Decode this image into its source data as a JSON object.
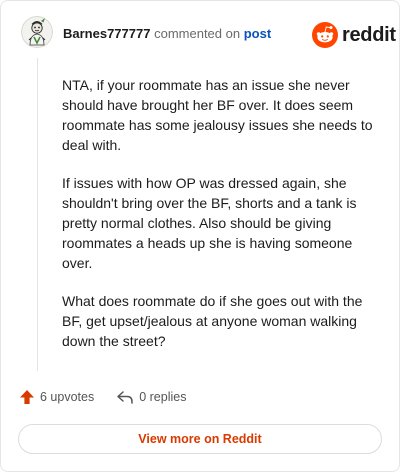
{
  "header": {
    "username": "Barnes777777",
    "action_text": "commented on",
    "post_link": "post",
    "brand": "reddit"
  },
  "comment": {
    "paragraphs": [
      "NTA, if your roommate has an issue she never should have brought her BF over. It does seem roommate has some jealousy issues she needs to deal with.",
      "If issues with how OP was dressed again, she shouldn't bring over the BF, shorts and a tank is pretty normal clothes. Also should be giving roommates a heads up she is having someone over.",
      "What does roommate do if she goes out with the BF, get upset/jealous at anyone woman walking down the street?"
    ]
  },
  "footer": {
    "upvotes": "6 upvotes",
    "replies": "0 replies",
    "view_more": "View more on Reddit"
  },
  "colors": {
    "brand_orange": "#ff4500",
    "upvote_orange": "#d93a00",
    "link_blue": "#0a53be"
  },
  "icons": {
    "avatar": "user-avatar",
    "logo": "reddit-snoo-icon",
    "upvote": "arrow-up-icon",
    "reply": "reply-arrow-icon"
  }
}
